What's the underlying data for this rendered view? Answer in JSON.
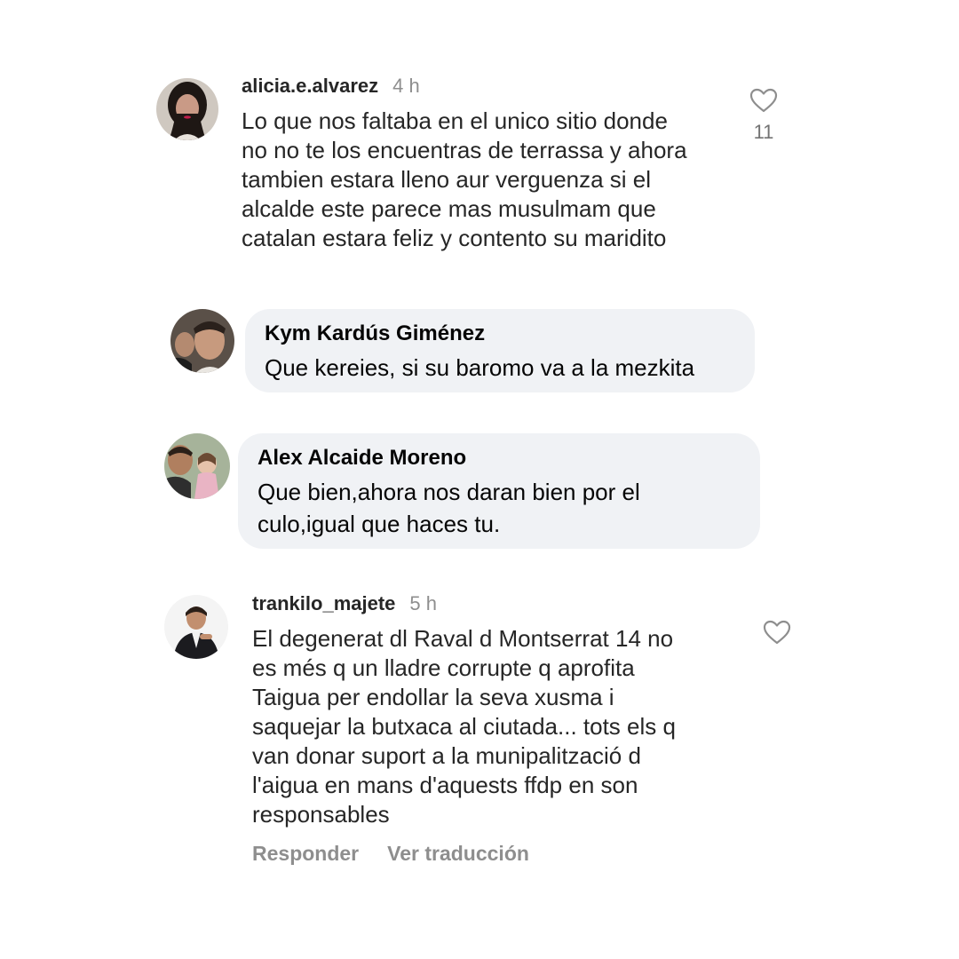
{
  "comments": [
    {
      "username": "alicia.e.alvarez",
      "time": "4 h",
      "text": "Lo que nos faltaba en el unico sitio donde\nno no te los encuentras de terrassa y ahora\ntambien estara lleno aur verguenza si el\nalcalde este parece mas musulmam que\ncatalan estara feliz y contento su maridito",
      "likes": "11"
    },
    {
      "name": "Kym Kardús Giménez",
      "text": "Que kereies, si su baromo va a la mezkita"
    },
    {
      "name": "Alex Alcaide Moreno",
      "text": "Que bien,ahora nos daran bien por el\nculo,igual que haces tu."
    },
    {
      "username": "trankilo_majete",
      "time": "5 h",
      "text": "El degenerat dl Raval d Montserrat 14 no\nes més q un lladre corrupte q aprofita\nTaigua per endollar la seva xusma i\nsaquejar la butxaca al ciutada... tots els q\nvan donar suport a la munipalització d\nl'aigua en mans d'aquests ffdp en son\nresponsables",
      "actions": {
        "reply": "Responder",
        "translate": "Ver traducción"
      }
    }
  ]
}
